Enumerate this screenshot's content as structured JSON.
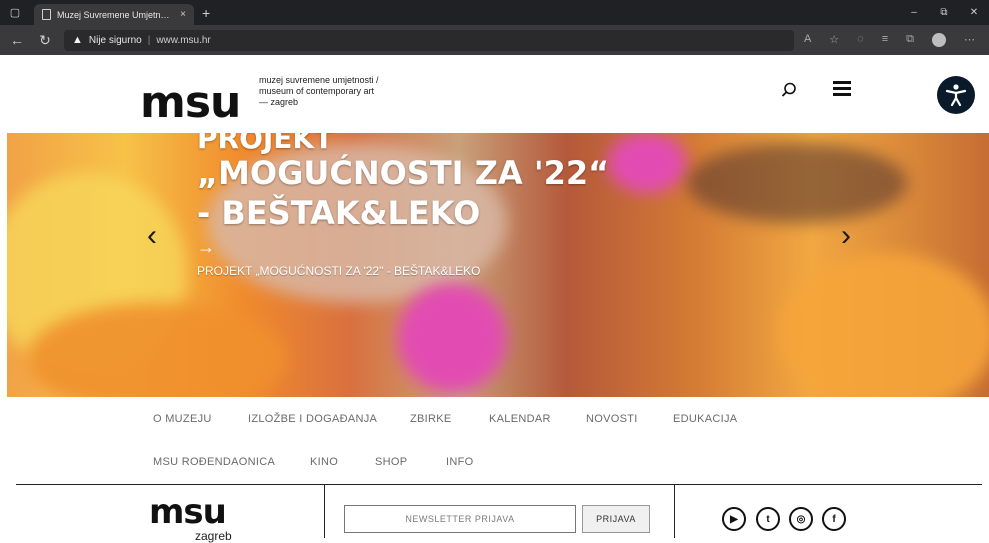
{
  "browser": {
    "tab_title": "Muzej Suvremene Umjetnosti, Za",
    "tab_close": "×",
    "new_tab": "+",
    "security_label": "Nije sigurno",
    "url": "www.msu.hr",
    "window_buttons": [
      "–",
      "⧉",
      "✕"
    ]
  },
  "header": {
    "logo": "msu",
    "tagline_lines": [
      "muzej suvremene umjetnosti /",
      "museum of contemporary art",
      "— zagreb"
    ],
    "icons": [
      "search-icon",
      "menu-icon",
      "accessibility-icon"
    ]
  },
  "hero": {
    "title_lines": [
      "PROJEKT",
      "„MOGUĆNOSTI ZA '22“",
      "- BEŠTAK&LEKO"
    ],
    "arrow": "→",
    "subtitle": "PROJEKT „MOGUĆNOSTI ZA '22\" - BEŠTAK&LEKO",
    "prev": "‹",
    "next": "›"
  },
  "nav": {
    "row1": [
      "O MUZEJU",
      "IZLOŽBE I DOGAĐANJA",
      "ZBIRKE",
      "KALENDAR",
      "NOVOSTI",
      "EDUKACIJA"
    ],
    "row2": [
      "MSU ROĐENDAONICA",
      "KINO",
      "SHOP",
      "INFO"
    ]
  },
  "footer": {
    "logo": "msu",
    "city": "zagreb",
    "newsletter_placeholder": "NEWSLETTER PRIJAVA",
    "subscribe_label": "PRIJAVA",
    "social": [
      "youtube-icon",
      "twitter-icon",
      "instagram-icon",
      "facebook-icon"
    ]
  }
}
